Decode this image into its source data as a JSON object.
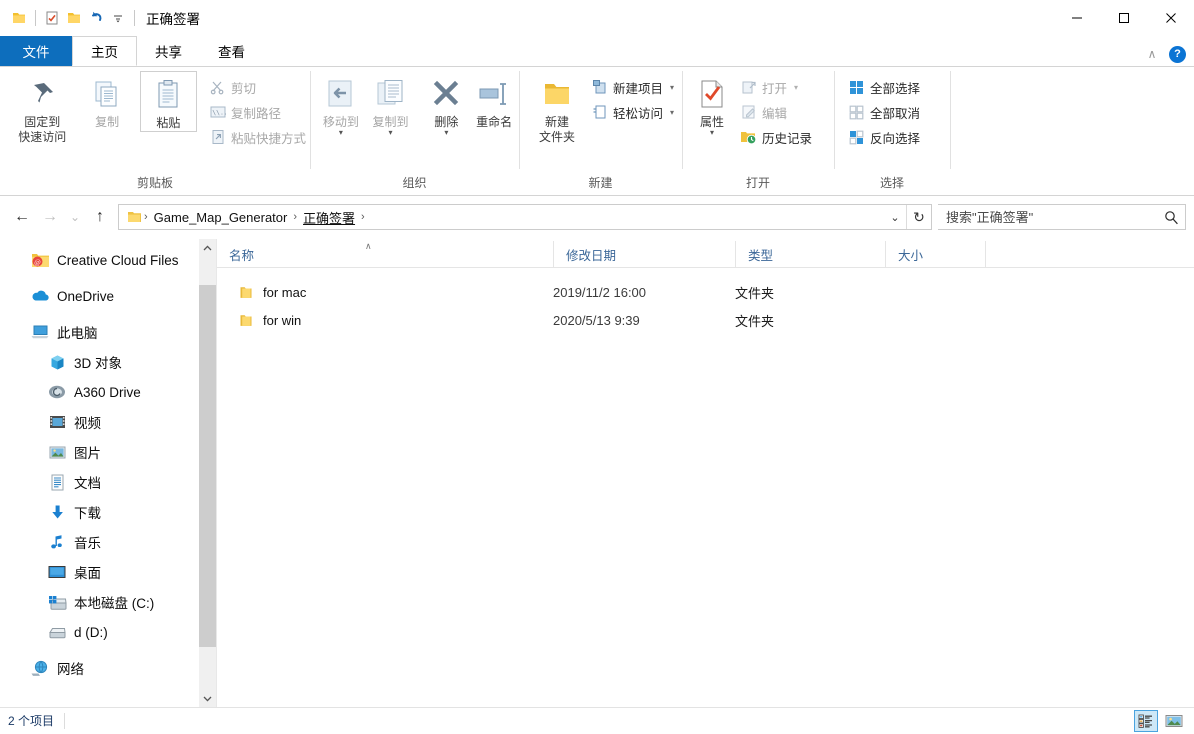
{
  "window": {
    "title": "正确签署",
    "quick_access": [
      {
        "name": "explorer-icon",
        "label": "资源管理器"
      },
      {
        "name": "properties-icon",
        "label": "属性"
      },
      {
        "name": "new-folder-icon",
        "label": "新建文件夹"
      },
      {
        "name": "undo-icon",
        "label": "撤消"
      },
      {
        "name": "customize-qat-icon",
        "label": "自定义快速访问工具栏"
      }
    ],
    "controls": {
      "minimize": "—",
      "maximize": "☐",
      "close": "✕"
    }
  },
  "tabs": [
    {
      "label": "文件",
      "type": "file"
    },
    {
      "label": "主页",
      "type": "active"
    },
    {
      "label": "共享",
      "type": "normal"
    },
    {
      "label": "查看",
      "type": "normal"
    }
  ],
  "tab_right": {
    "collapse_label": "∧",
    "help_label": "?"
  },
  "ribbon": {
    "groups": [
      {
        "label": "剪贴板",
        "big": [
          {
            "label_line1": "固定到",
            "label_line2": "快速访问",
            "icon": "pin-icon",
            "disabled": false,
            "selected": false
          },
          {
            "label_line1": "复制",
            "label_line2": "",
            "icon": "copy-icon",
            "disabled": true,
            "selected": false
          },
          {
            "label_line1": "粘贴",
            "label_line2": "",
            "icon": "paste-icon",
            "disabled": false,
            "selected": true
          }
        ],
        "small": [
          {
            "label": "剪切",
            "icon": "scissors-icon",
            "disabled": true,
            "caret": false
          },
          {
            "label": "复制路径",
            "icon": "copy-path-icon",
            "disabled": true,
            "caret": false
          },
          {
            "label": "粘贴快捷方式",
            "icon": "paste-shortcut-icon",
            "disabled": true,
            "caret": false
          }
        ]
      },
      {
        "label": "组织",
        "big": [
          {
            "label_line1": "移动到",
            "label_line2": "",
            "icon": "move-to-icon",
            "disabled": true,
            "selected": false,
            "dropdown": true
          },
          {
            "label_line1": "复制到",
            "label_line2": "",
            "icon": "copy-to-icon",
            "disabled": true,
            "selected": false,
            "dropdown": true
          },
          {
            "label_line1": "删除",
            "label_line2": "",
            "icon": "delete-icon",
            "disabled": false,
            "selected": false,
            "dropdown": true
          },
          {
            "label_line1": "重命名",
            "label_line2": "",
            "icon": "rename-icon",
            "disabled": false,
            "selected": false
          }
        ],
        "small": []
      },
      {
        "label": "新建",
        "big": [
          {
            "label_line1": "新建",
            "label_line2": "文件夹",
            "icon": "new-folder-large-icon",
            "disabled": false,
            "selected": false
          }
        ],
        "small": [
          {
            "label": "新建项目",
            "icon": "new-item-icon",
            "disabled": false,
            "caret": true
          },
          {
            "label": "轻松访问",
            "icon": "easy-access-icon",
            "disabled": false,
            "caret": true
          }
        ]
      },
      {
        "label": "打开",
        "big": [
          {
            "label_line1": "属性",
            "label_line2": "",
            "icon": "properties-large-icon",
            "disabled": false,
            "selected": false,
            "dropdown": true
          }
        ],
        "small": [
          {
            "label": "打开",
            "icon": "open-icon",
            "disabled": true,
            "caret": true
          },
          {
            "label": "编辑",
            "icon": "edit-icon",
            "disabled": true,
            "caret": false
          },
          {
            "label": "历史记录",
            "icon": "history-icon",
            "disabled": false,
            "caret": false
          }
        ]
      },
      {
        "label": "选择",
        "big": [],
        "small": [
          {
            "label": "全部选择",
            "icon": "select-all-icon",
            "disabled": false,
            "caret": false
          },
          {
            "label": "全部取消",
            "icon": "select-none-icon",
            "disabled": false,
            "caret": false
          },
          {
            "label": "反向选择",
            "icon": "invert-selection-icon",
            "disabled": false,
            "caret": false
          }
        ]
      }
    ]
  },
  "navbar": {
    "back": "←",
    "forward": "→",
    "recent": "⌄",
    "up": "↑",
    "breadcrumbs": [
      "Game_Map_Generator",
      "正确签署"
    ],
    "crumb_separator": "›",
    "dropdown": "⌄",
    "refresh": "↻",
    "search_placeholder": "搜索\"正确签署\"",
    "search_value": ""
  },
  "navpane": {
    "items": [
      {
        "label": "Creative Cloud Files",
        "icon": "creative-cloud-icon",
        "level": 0,
        "gap_after": true
      },
      {
        "label": "OneDrive",
        "icon": "onedrive-icon",
        "level": 0,
        "gap_after": true
      },
      {
        "label": "此电脑",
        "icon": "this-pc-icon",
        "level": 0,
        "gap_after": false
      },
      {
        "label": "3D 对象",
        "icon": "3d-objects-icon",
        "level": 1,
        "gap_after": false
      },
      {
        "label": "A360 Drive",
        "icon": "a360-drive-icon",
        "level": 1,
        "gap_after": false
      },
      {
        "label": "视频",
        "icon": "videos-icon",
        "level": 1,
        "gap_after": false
      },
      {
        "label": "图片",
        "icon": "pictures-icon",
        "level": 1,
        "gap_after": false
      },
      {
        "label": "文档",
        "icon": "documents-icon",
        "level": 1,
        "gap_after": false
      },
      {
        "label": "下载",
        "icon": "downloads-icon",
        "level": 1,
        "gap_after": false
      },
      {
        "label": "音乐",
        "icon": "music-icon",
        "level": 1,
        "gap_after": false
      },
      {
        "label": "桌面",
        "icon": "desktop-icon",
        "level": 1,
        "gap_after": false
      },
      {
        "label": "本地磁盘 (C:)",
        "icon": "local-disk-icon",
        "level": 1,
        "gap_after": false
      },
      {
        "label": "d (D:)",
        "icon": "disk-icon",
        "level": 1,
        "gap_after": true
      },
      {
        "label": "网络",
        "icon": "network-icon",
        "level": 0,
        "gap_after": false
      }
    ]
  },
  "filelist": {
    "columns": [
      {
        "label": "名称",
        "key": "name"
      },
      {
        "label": "修改日期",
        "key": "date"
      },
      {
        "label": "类型",
        "key": "type"
      },
      {
        "label": "大小",
        "key": "size"
      }
    ],
    "sort_indicator": "∧",
    "rows": [
      {
        "name": "for mac",
        "date": "2019/11/2 16:00",
        "type": "文件夹",
        "size": "",
        "icon": "folder-icon"
      },
      {
        "name": "for win",
        "date": "2020/5/13 9:39",
        "type": "文件夹",
        "size": "",
        "icon": "folder-icon"
      }
    ]
  },
  "statusbar": {
    "item_count": "2 个项目",
    "views": [
      {
        "name": "details-view",
        "active": true
      },
      {
        "name": "large-icons-view",
        "active": false
      }
    ]
  }
}
